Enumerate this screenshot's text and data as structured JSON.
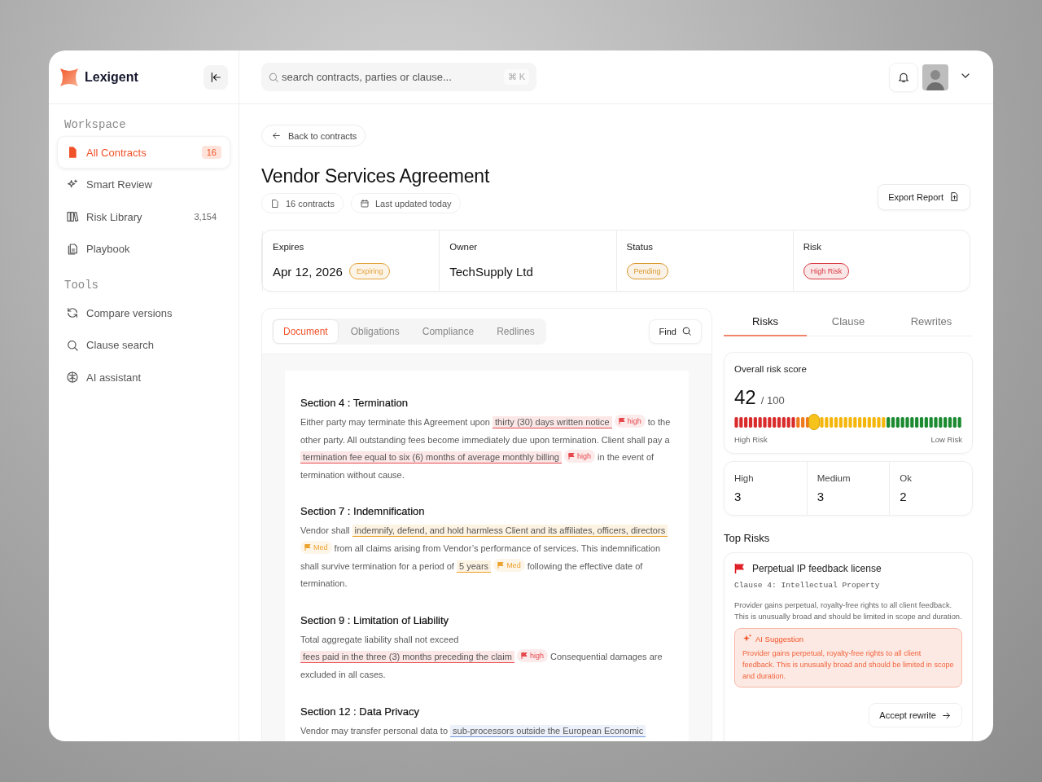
{
  "brand": {
    "name": "Lexigent"
  },
  "search": {
    "placeholder": "search contracts, parties or clause...",
    "shortcut": "⌘ K"
  },
  "sidebar": {
    "sections": [
      {
        "title": "Workspace",
        "items": [
          {
            "label": "All Contracts",
            "count": "16",
            "selected": true
          },
          {
            "label": "Smart Review",
            "selected": false
          },
          {
            "label": "Risk Library",
            "count": "3,154",
            "selected": false
          },
          {
            "label": "Playbook",
            "selected": false
          }
        ]
      },
      {
        "title": "Tools",
        "items": [
          {
            "label": "Compare versions",
            "selected": false
          },
          {
            "label": "Clause search",
            "selected": false
          },
          {
            "label": "AI assistant",
            "selected": false
          }
        ]
      }
    ]
  },
  "page": {
    "back": "Back to contracts",
    "title": "Vendor Services Agreement",
    "meta": [
      "16 contracts",
      "Last updated today"
    ],
    "export": "Export Report"
  },
  "summary": [
    {
      "label": "Expires",
      "value": "Apr 12, 2026",
      "badge": "Expiring",
      "color": "#e3a23c"
    },
    {
      "label": "Owner",
      "value": "TechSupply Ltd"
    },
    {
      "label": "Status",
      "badge": "Pending",
      "color": "#d9982f"
    },
    {
      "label": "Risk",
      "badge": "High Risk",
      "color": "#d93a42"
    }
  ],
  "document": {
    "tabs": [
      {
        "label": "Document",
        "selected": true
      },
      {
        "label": "Obligations",
        "selected": false
      },
      {
        "label": "Compliance",
        "selected": false
      },
      {
        "label": "Redlines",
        "selected": false
      }
    ],
    "find": "Find",
    "sections": [
      {
        "title": "Section 4 : Termination",
        "parts": [
          {
            "kind": "text",
            "text": "Either party may terminate this Agreement upon"
          },
          {
            "kind": "mark",
            "color": "#e5484d",
            "text": "thirty (30) days written notice"
          },
          {
            "kind": "flag",
            "color": "#e5484d",
            "text": "high"
          },
          {
            "kind": "text",
            "text": "to the other party. All outstanding fees become immediately due upon termination. Client shall pay a"
          },
          {
            "kind": "mark",
            "color": "#e5484d",
            "text": "termination fee equal to six (6) months of average monthly billing"
          },
          {
            "kind": "flag",
            "color": "#e5484d",
            "text": "high"
          },
          {
            "kind": "text",
            "text": "in the event of termination without cause."
          }
        ]
      },
      {
        "title": "Section 7 : Indemnification",
        "parts": [
          {
            "kind": "text",
            "text": "Vendor shall"
          },
          {
            "kind": "mark",
            "color": "#eda22e",
            "text": "indemnify, defend, and hold harmless Client and its affiliates, officers, directors"
          },
          {
            "kind": "flag",
            "color": "#eda22e",
            "text": "Med"
          },
          {
            "kind": "text",
            "text": "from all claims arising from Vendor’s performance of services. This indemnification shall survive termination for a period of"
          },
          {
            "kind": "mark",
            "color": "#eda22e",
            "text": "5 years"
          },
          {
            "kind": "flag",
            "color": "#eda22e",
            "text": "Med"
          },
          {
            "kind": "text",
            "text": "following the effective date of termination."
          }
        ]
      },
      {
        "title": "Section 9 : Limitation of Liability",
        "parts": [
          {
            "kind": "text",
            "text": "Total aggregate liability shall not exceed"
          },
          {
            "kind": "mark",
            "color": "#e5484d",
            "text": "fees paid in the three (3) months preceding the claim"
          },
          {
            "kind": "flag",
            "color": "#e5484d",
            "text": "high"
          },
          {
            "kind": "text",
            "text": "Consequential damages are excluded in all cases."
          }
        ]
      },
      {
        "title": "Section 12 : Data Privacy",
        "parts": [
          {
            "kind": "text",
            "text": "Vendor may transfer personal data to"
          },
          {
            "kind": "mark",
            "color": "#6f95d8",
            "text": "sub-processors outside the European Economic"
          }
        ]
      }
    ]
  },
  "risk_panel": {
    "tabs": [
      {
        "label": "Risks",
        "selected": true
      },
      {
        "label": "Clause",
        "selected": false
      },
      {
        "label": "Rewrites",
        "selected": false
      }
    ],
    "score": {
      "title": "Overall risk score",
      "value": "42",
      "total": "/ 100",
      "level": 0.35,
      "start_label": "High Risk",
      "end_label": "Low Risk"
    },
    "counts": [
      {
        "label": "High",
        "value": "3"
      },
      {
        "label": "Medium",
        "value": "3"
      },
      {
        "label": "Ok",
        "value": "2"
      }
    ],
    "top_title": "Top Risks",
    "top_risks": [
      {
        "title": "Perpetual IP feedback license",
        "clause": "Clause 4: Intellectual Property",
        "description": "Provider gains perpetual, royalty-free rights to all client feedback. This is unusually broad and should be limited in scope and duration.",
        "suggestion_title": "AI Suggestion",
        "suggestion": "Provider gains perpetual, royalty-free rights to all client feedback. This is unusually broad and should be limited in scope and duration.",
        "action": "Accept rewrite"
      }
    ]
  }
}
